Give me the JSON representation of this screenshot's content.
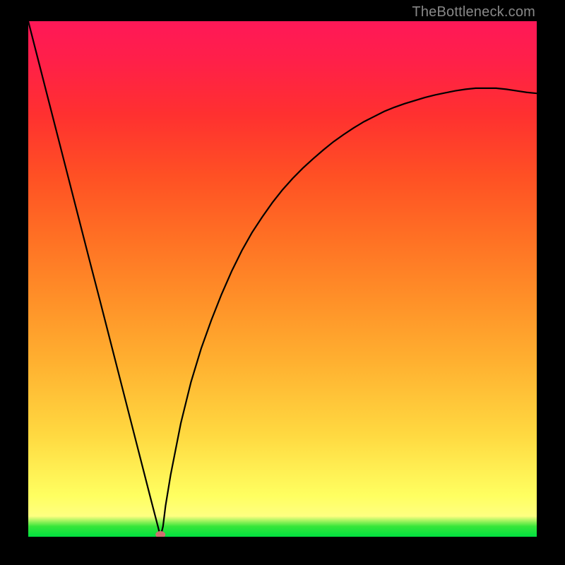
{
  "chart_data": {
    "type": "line",
    "title": "",
    "xlabel": "",
    "ylabel": "",
    "xlim": [
      0,
      100
    ],
    "ylim": [
      0,
      100
    ],
    "x": [
      0,
      2,
      4,
      6,
      8,
      10,
      12,
      14,
      16,
      18,
      20,
      22,
      24,
      25.5,
      26,
      26.5,
      27,
      28,
      30,
      32,
      34,
      36,
      38,
      40,
      42,
      44,
      46,
      48,
      50,
      52,
      54,
      56,
      58,
      60,
      62,
      64,
      66,
      68,
      70,
      72,
      74,
      76,
      78,
      80,
      82,
      84,
      86,
      88,
      90,
      92,
      94,
      96,
      98,
      100
    ],
    "y": [
      100,
      92.3,
      84.6,
      76.9,
      69.2,
      61.5,
      53.8,
      46.2,
      38.5,
      30.8,
      23.1,
      15.4,
      7.7,
      2.0,
      0.0,
      2.0,
      6.0,
      12.0,
      22.0,
      30.0,
      36.5,
      42.0,
      47.0,
      51.5,
      55.5,
      59.0,
      62.0,
      64.8,
      67.3,
      69.5,
      71.5,
      73.3,
      75.0,
      76.6,
      78.0,
      79.3,
      80.5,
      81.5,
      82.5,
      83.3,
      84.0,
      84.6,
      85.2,
      85.7,
      86.1,
      86.5,
      86.8,
      87.0,
      87.0,
      87.0,
      86.8,
      86.5,
      86.2,
      86.0
    ],
    "minimum_point": {
      "x": 26,
      "y": 0
    },
    "legend": []
  },
  "ui": {
    "watermark": "TheBottleneck.com"
  }
}
